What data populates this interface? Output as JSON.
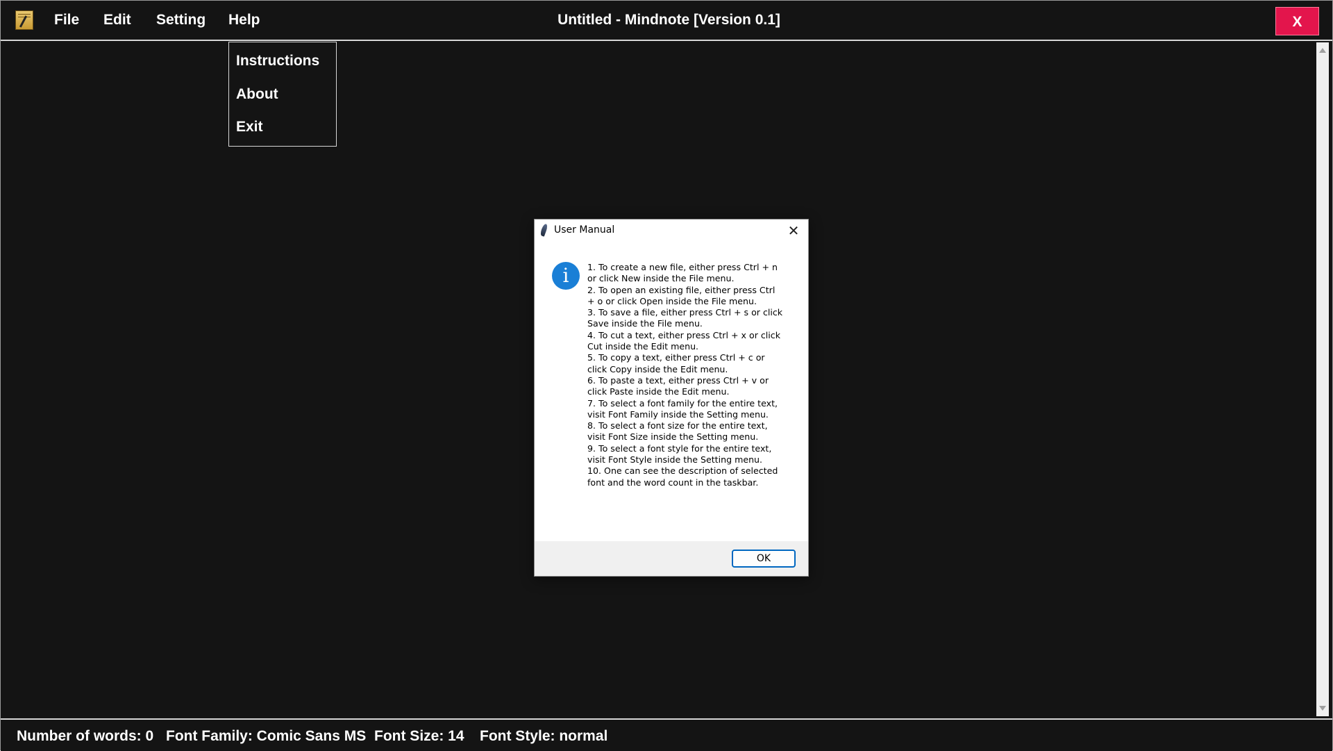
{
  "app": {
    "icon": "notepad-quill-icon",
    "title": "Untitled - Mindnote [Version 0.1]",
    "close_label": "X",
    "close_color": "#e3154c"
  },
  "menubar": {
    "file": "File",
    "edit": "Edit",
    "setting": "Setting",
    "help": "Help"
  },
  "help_menu": {
    "items": [
      "Instructions",
      "About",
      "Exit"
    ]
  },
  "dialog": {
    "title": "User Manual",
    "icon": "feather-icon",
    "message_icon": "info-icon",
    "message_icon_glyph": "i",
    "lines": [
      "1. To create a new file, either press Ctrl + n",
      "or click New inside the File menu.",
      "2. To open an existing file, either press Ctrl",
      "+ o or click Open inside the File menu.",
      "3. To save a file, either press Ctrl + s or click",
      "Save inside the File menu.",
      "4. To cut a text, either press Ctrl + x or click",
      "Cut inside the Edit menu.",
      "5. To copy a text, either press Ctrl + c or",
      "click Copy inside the Edit menu.",
      "6. To paste a text, either press Ctrl + v or",
      "click Paste inside the Edit menu.",
      "7. To select a font family for the entire text,",
      "visit Font Family inside the Setting menu.",
      "8. To select a font size for the entire text,",
      "visit Font Size inside the Setting menu.",
      "9. To select a font style for the entire text,",
      "visit Font Style inside the Setting menu.",
      "10. One can see the description of selected",
      "font and the word count in the taskbar."
    ],
    "ok_label": "OK",
    "close_glyph": "✕"
  },
  "statusbar": {
    "words": "Number of words: 0",
    "font_family": "Font Family: Comic Sans MS",
    "font_size": "Font Size: 14",
    "font_style": "Font Style: normal"
  },
  "colors": {
    "background": "#141414",
    "accent_blue": "#0067c0"
  }
}
